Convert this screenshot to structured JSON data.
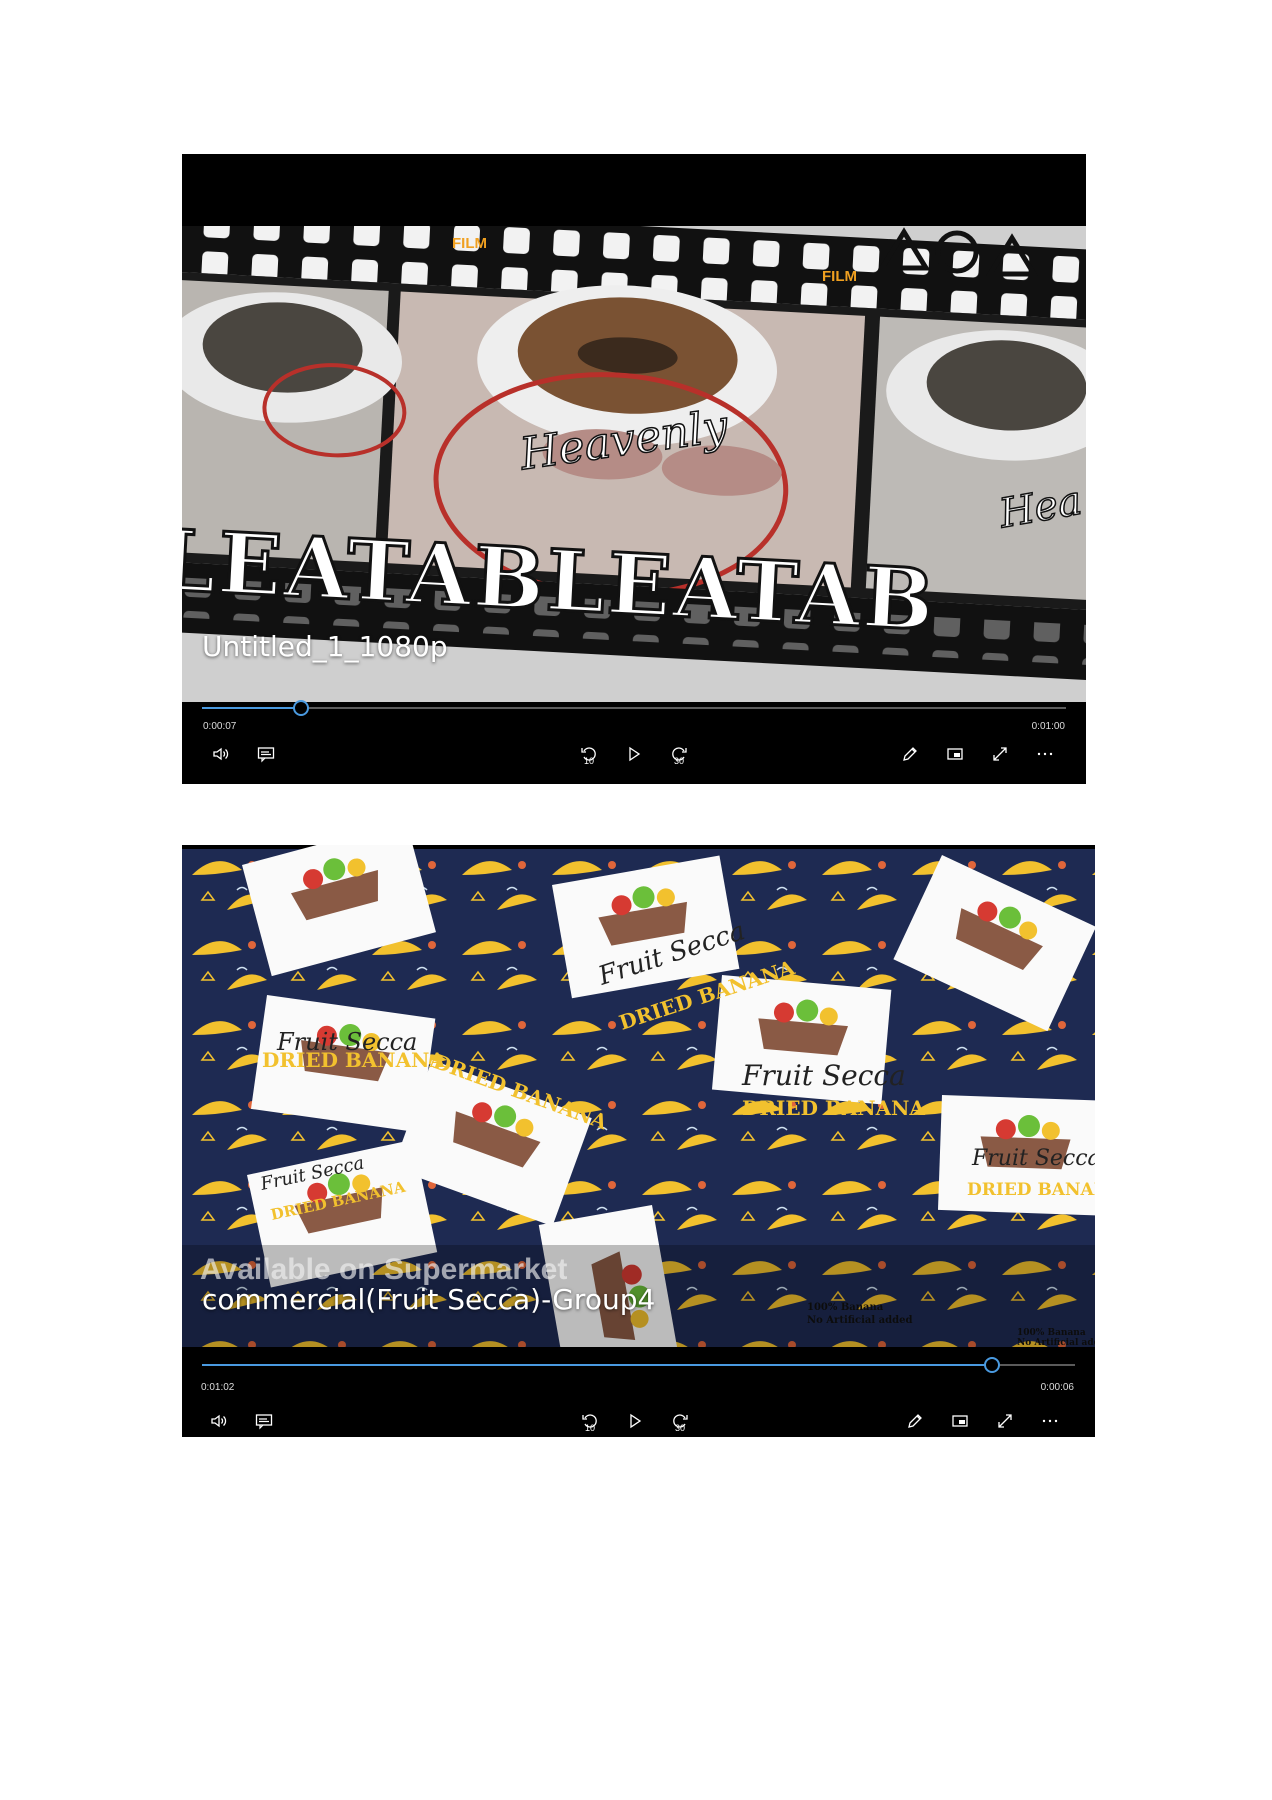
{
  "players": [
    {
      "title": "Untitled_1_1080p",
      "elapsed": "0:00:07",
      "remaining": "0:01:00",
      "progress": 0.115,
      "frame": {
        "film_label_1": "FILM",
        "film_label_2": "FILM",
        "script_word": "Heavenly",
        "block_word": "LEATABLEATAB",
        "script_word_2": "Hea"
      },
      "controls": {
        "skip_back": "10",
        "skip_forward": "30"
      }
    },
    {
      "title": "commercial(Fruit Secca)-Group4",
      "overlay_caption": "Available on Supermarket",
      "elapsed": "0:01:02",
      "remaining": "0:00:06",
      "progress": 0.905,
      "frame": {
        "brand": "Fruit Secca",
        "product": "DRIED BANANA",
        "label_line_1": "100% Banana",
        "label_line_2": "No Artificial added"
      },
      "controls": {
        "skip_back": "10",
        "skip_forward": "30"
      }
    }
  ],
  "colors": {
    "accent": "#4a9ae0",
    "player_bg": "#000000",
    "banana_yellow": "#f2c12e",
    "navy_pattern": "#1e2a52"
  },
  "icons": [
    "volume-icon",
    "captions-icon",
    "skip-back-10-icon",
    "play-icon",
    "skip-forward-30-icon",
    "edit-icon",
    "mini-view-icon",
    "fullscreen-icon",
    "more-icon"
  ]
}
